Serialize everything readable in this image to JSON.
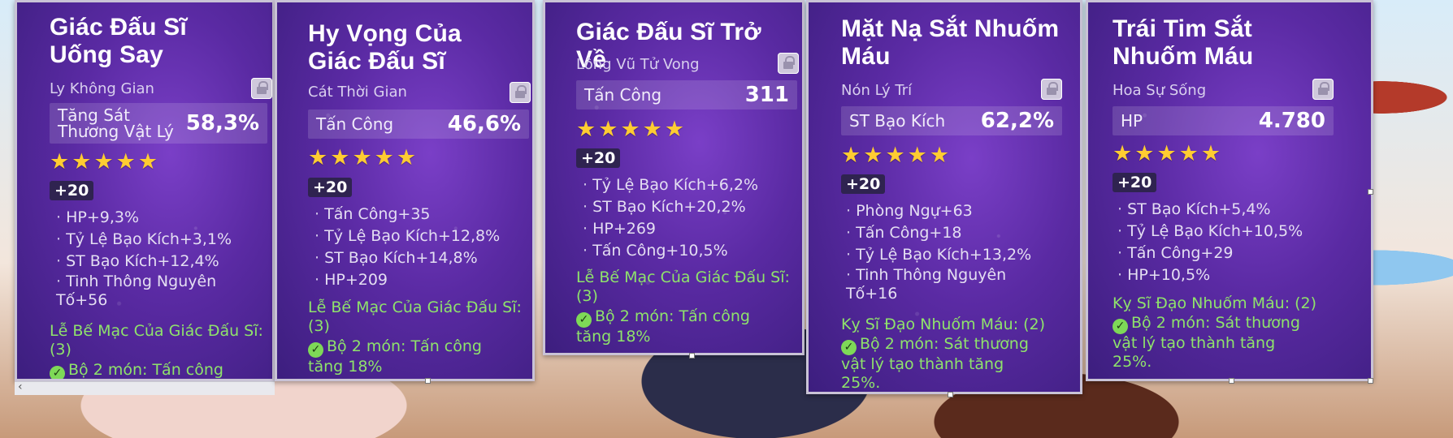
{
  "cards": [
    {
      "title": "Giác Đấu Sĩ Uống Say",
      "slot": "Ly Không Gian",
      "main_stat_name": "Tăng Sát Thương Vật Lý",
      "main_stat_value": "58,3%",
      "level": "+20",
      "stars": 5,
      "substats": [
        "HP+9,3%",
        "Tỷ Lệ Bạo Kích+3,1%",
        "ST Bạo Kích+12,4%",
        "Tinh Thông Nguyên Tố+56"
      ],
      "set_name": "Lễ Bế Mạc Của Giác Đấu Sĩ: (3)",
      "bonus": "Bộ 2 món: Tấn công"
    },
    {
      "title": "Hy Vọng Của Giác Đấu Sĩ",
      "slot": "Cát Thời Gian",
      "main_stat_name": "Tấn Công",
      "main_stat_value": "46,6%",
      "level": "+20",
      "stars": 5,
      "substats": [
        "Tấn Công+35",
        "Tỷ Lệ Bạo Kích+12,8%",
        "ST Bạo Kích+14,8%",
        "HP+209"
      ],
      "set_name": "Lễ Bế Mạc Của Giác Đấu Sĩ: (3)",
      "bonus": "Bộ 2 món: Tấn công tăng 18%"
    },
    {
      "title": "Giác Đấu Sĩ Trở Về",
      "slot": "Lông Vũ Tử Vong",
      "main_stat_name": "Tấn Công",
      "main_stat_value": "311",
      "level": "+20",
      "stars": 5,
      "substats": [
        "Tỷ Lệ Bạo Kích+6,2%",
        "ST Bạo Kích+20,2%",
        "HP+269",
        "Tấn Công+10,5%"
      ],
      "set_name": "Lễ Bế Mạc Của Giác Đấu Sĩ: (3)",
      "bonus": "Bộ 2 món: Tấn công tăng 18%"
    },
    {
      "title": "Mặt Nạ Sắt Nhuốm Máu",
      "slot": "Nón Lý Trí",
      "main_stat_name": "ST Bạo Kích",
      "main_stat_value": "62,2%",
      "level": "+20",
      "stars": 5,
      "substats": [
        "Phòng Ngự+63",
        "Tấn Công+18",
        "Tỷ Lệ Bạo Kích+13,2%",
        "Tinh Thông Nguyên Tố+16"
      ],
      "set_name": "Kỵ Sĩ Đạo Nhuốm Máu: (2)",
      "bonus": "Bộ 2 món: Sát thương vật lý tạo thành tăng 25%."
    },
    {
      "title": "Trái Tim Sắt Nhuốm Máu",
      "slot": "Hoa Sự Sống",
      "main_stat_name": "HP",
      "main_stat_value": "4.780",
      "level": "+20",
      "stars": 5,
      "substats": [
        "ST Bạo Kích+5,4%",
        "Tỷ Lệ Bạo Kích+10,5%",
        "Tấn Công+29",
        "HP+10,5%"
      ],
      "set_name": "Kỵ Sĩ Đạo Nhuốm Máu: (2)",
      "bonus": "Bộ 2 món: Sát thương vật lý tạo thành tăng 25%."
    }
  ],
  "ui": {
    "star_glyph": "★",
    "check_glyph": "✓",
    "scroll_arrow": "‹"
  }
}
